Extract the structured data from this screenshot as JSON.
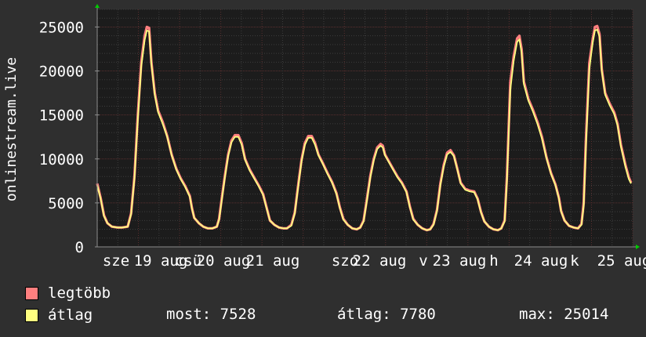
{
  "chart_data": {
    "type": "area",
    "ylabel": "onlinestream.live",
    "ylim": [
      0,
      27000
    ],
    "y_ticks": [
      "0",
      "5000",
      "10000",
      "15000",
      "20000",
      "25000"
    ],
    "x_tick_labels": [
      "sze",
      "19 aug",
      "csü",
      "20 aug",
      "21 aug",
      "szo",
      "22 aug",
      "v",
      "23 aug",
      "h",
      "24 aug",
      "k",
      "25 aug"
    ],
    "grid": true,
    "series": [
      {
        "name": "legtöbb",
        "color": "#ff7f7f",
        "points": [
          [
            0,
            7200
          ],
          [
            3,
            5600
          ],
          [
            6,
            3600
          ],
          [
            9,
            2700
          ],
          [
            13,
            2300
          ],
          [
            18,
            2200
          ],
          [
            22,
            2200
          ],
          [
            27,
            2300
          ],
          [
            30,
            3800
          ],
          [
            33,
            8000
          ],
          [
            36,
            15000
          ],
          [
            39,
            21000
          ],
          [
            42,
            24000
          ],
          [
            44,
            25000
          ],
          [
            46,
            24900
          ],
          [
            48,
            21000
          ],
          [
            51,
            17500
          ],
          [
            54,
            15500
          ],
          [
            58,
            14200
          ],
          [
            62,
            12600
          ],
          [
            66,
            10500
          ],
          [
            70,
            8900
          ],
          [
            74,
            7800
          ],
          [
            78,
            6900
          ],
          [
            82,
            5800
          ],
          [
            84,
            4400
          ],
          [
            86,
            3300
          ],
          [
            90,
            2700
          ],
          [
            94,
            2300
          ],
          [
            98,
            2100
          ],
          [
            102,
            2100
          ],
          [
            106,
            2300
          ],
          [
            108,
            3200
          ],
          [
            110,
            5200
          ],
          [
            113,
            8000
          ],
          [
            116,
            10500
          ],
          [
            119,
            12100
          ],
          [
            122,
            12700
          ],
          [
            125,
            12700
          ],
          [
            128,
            11800
          ],
          [
            131,
            10000
          ],
          [
            135,
            8800
          ],
          [
            139,
            7900
          ],
          [
            143,
            7000
          ],
          [
            147,
            6000
          ],
          [
            150,
            4500
          ],
          [
            153,
            3000
          ],
          [
            157,
            2500
          ],
          [
            161,
            2200
          ],
          [
            165,
            2100
          ],
          [
            168,
            2100
          ],
          [
            172,
            2500
          ],
          [
            175,
            3900
          ],
          [
            178,
            7000
          ],
          [
            181,
            9900
          ],
          [
            184,
            11800
          ],
          [
            187,
            12600
          ],
          [
            190,
            12600
          ],
          [
            193,
            11800
          ],
          [
            196,
            10500
          ],
          [
            200,
            9500
          ],
          [
            204,
            8400
          ],
          [
            208,
            7400
          ],
          [
            212,
            6100
          ],
          [
            215,
            4500
          ],
          [
            218,
            3200
          ],
          [
            222,
            2500
          ],
          [
            226,
            2100
          ],
          [
            230,
            2000
          ],
          [
            233,
            2200
          ],
          [
            236,
            3000
          ],
          [
            239,
            5500
          ],
          [
            242,
            8100
          ],
          [
            245,
            10000
          ],
          [
            248,
            11300
          ],
          [
            251,
            11700
          ],
          [
            253,
            11500
          ],
          [
            255,
            10500
          ],
          [
            258,
            9800
          ],
          [
            262,
            8900
          ],
          [
            266,
            8000
          ],
          [
            270,
            7300
          ],
          [
            274,
            6300
          ],
          [
            277,
            4600
          ],
          [
            280,
            3200
          ],
          [
            284,
            2500
          ],
          [
            288,
            2100
          ],
          [
            292,
            1900
          ],
          [
            295,
            2000
          ],
          [
            298,
            2600
          ],
          [
            301,
            4200
          ],
          [
            304,
            7200
          ],
          [
            307,
            9300
          ],
          [
            310,
            10700
          ],
          [
            313,
            11000
          ],
          [
            316,
            10400
          ],
          [
            319,
            8900
          ],
          [
            322,
            7300
          ],
          [
            326,
            6600
          ],
          [
            330,
            6400
          ],
          [
            334,
            6300
          ],
          [
            337,
            5500
          ],
          [
            340,
            4000
          ],
          [
            343,
            2900
          ],
          [
            347,
            2300
          ],
          [
            351,
            2000
          ],
          [
            355,
            1900
          ],
          [
            358,
            2100
          ],
          [
            361,
            3000
          ],
          [
            363,
            8000
          ],
          [
            366,
            18700
          ],
          [
            369,
            21700
          ],
          [
            372,
            23700
          ],
          [
            374,
            24000
          ],
          [
            376,
            22500
          ],
          [
            378,
            18800
          ],
          [
            382,
            16800
          ],
          [
            386,
            15600
          ],
          [
            390,
            14200
          ],
          [
            394,
            12500
          ],
          [
            398,
            10200
          ],
          [
            402,
            8400
          ],
          [
            406,
            7100
          ],
          [
            409,
            5600
          ],
          [
            411,
            4100
          ],
          [
            414,
            3000
          ],
          [
            418,
            2400
          ],
          [
            422,
            2200
          ],
          [
            426,
            2100
          ],
          [
            429,
            2600
          ],
          [
            431,
            5000
          ],
          [
            433,
            12300
          ],
          [
            436,
            20900
          ],
          [
            439,
            23600
          ],
          [
            441,
            25000
          ],
          [
            443,
            25100
          ],
          [
            445,
            24200
          ],
          [
            447,
            20200
          ],
          [
            450,
            17500
          ],
          [
            454,
            16300
          ],
          [
            458,
            15300
          ],
          [
            461,
            14000
          ],
          [
            464,
            11600
          ],
          [
            468,
            9300
          ],
          [
            471,
            7900
          ],
          [
            473,
            7300
          ]
        ]
      },
      {
        "name": "átlag",
        "color": "#ffff80",
        "points": [
          [
            0,
            7000
          ],
          [
            3,
            5500
          ],
          [
            6,
            3500
          ],
          [
            9,
            2700
          ],
          [
            13,
            2300
          ],
          [
            18,
            2200
          ],
          [
            22,
            2200
          ],
          [
            27,
            2300
          ],
          [
            30,
            3700
          ],
          [
            33,
            7800
          ],
          [
            36,
            14500
          ],
          [
            39,
            20500
          ],
          [
            42,
            23500
          ],
          [
            44,
            24600
          ],
          [
            46,
            24500
          ],
          [
            48,
            20800
          ],
          [
            51,
            17300
          ],
          [
            54,
            15300
          ],
          [
            58,
            14000
          ],
          [
            62,
            12500
          ],
          [
            66,
            10400
          ],
          [
            70,
            8800
          ],
          [
            74,
            7700
          ],
          [
            78,
            6800
          ],
          [
            82,
            5700
          ],
          [
            84,
            4300
          ],
          [
            86,
            3300
          ],
          [
            90,
            2700
          ],
          [
            94,
            2300
          ],
          [
            98,
            2100
          ],
          [
            102,
            2100
          ],
          [
            106,
            2300
          ],
          [
            108,
            3100
          ],
          [
            110,
            5000
          ],
          [
            113,
            7800
          ],
          [
            116,
            10300
          ],
          [
            119,
            11900
          ],
          [
            122,
            12500
          ],
          [
            125,
            12500
          ],
          [
            128,
            11600
          ],
          [
            131,
            9900
          ],
          [
            135,
            8700
          ],
          [
            139,
            7800
          ],
          [
            143,
            6900
          ],
          [
            147,
            5900
          ],
          [
            150,
            4400
          ],
          [
            153,
            3000
          ],
          [
            157,
            2500
          ],
          [
            161,
            2200
          ],
          [
            165,
            2100
          ],
          [
            168,
            2100
          ],
          [
            172,
            2400
          ],
          [
            175,
            3800
          ],
          [
            178,
            6800
          ],
          [
            181,
            9700
          ],
          [
            184,
            11600
          ],
          [
            187,
            12400
          ],
          [
            190,
            12400
          ],
          [
            193,
            11600
          ],
          [
            196,
            10400
          ],
          [
            200,
            9400
          ],
          [
            204,
            8300
          ],
          [
            208,
            7300
          ],
          [
            212,
            6000
          ],
          [
            215,
            4400
          ],
          [
            218,
            3100
          ],
          [
            222,
            2500
          ],
          [
            226,
            2100
          ],
          [
            230,
            2000
          ],
          [
            233,
            2200
          ],
          [
            236,
            2900
          ],
          [
            239,
            5300
          ],
          [
            242,
            7900
          ],
          [
            245,
            9800
          ],
          [
            248,
            11100
          ],
          [
            251,
            11500
          ],
          [
            253,
            11300
          ],
          [
            255,
            10400
          ],
          [
            258,
            9700
          ],
          [
            262,
            8800
          ],
          [
            266,
            7900
          ],
          [
            270,
            7200
          ],
          [
            274,
            6200
          ],
          [
            277,
            4500
          ],
          [
            280,
            3100
          ],
          [
            284,
            2500
          ],
          [
            288,
            2100
          ],
          [
            292,
            1900
          ],
          [
            295,
            2000
          ],
          [
            298,
            2500
          ],
          [
            301,
            4100
          ],
          [
            304,
            7000
          ],
          [
            307,
            9100
          ],
          [
            310,
            10500
          ],
          [
            313,
            10800
          ],
          [
            316,
            10300
          ],
          [
            319,
            8800
          ],
          [
            322,
            7200
          ],
          [
            326,
            6500
          ],
          [
            330,
            6300
          ],
          [
            334,
            6200
          ],
          [
            337,
            5400
          ],
          [
            340,
            3900
          ],
          [
            343,
            2900
          ],
          [
            347,
            2300
          ],
          [
            351,
            2000
          ],
          [
            355,
            1900
          ],
          [
            358,
            2100
          ],
          [
            361,
            2900
          ],
          [
            363,
            7500
          ],
          [
            366,
            17800
          ],
          [
            369,
            21200
          ],
          [
            372,
            23300
          ],
          [
            374,
            23600
          ],
          [
            376,
            22100
          ],
          [
            378,
            18500
          ],
          [
            382,
            16600
          ],
          [
            386,
            15400
          ],
          [
            390,
            14000
          ],
          [
            394,
            12300
          ],
          [
            398,
            10100
          ],
          [
            402,
            8300
          ],
          [
            406,
            7000
          ],
          [
            409,
            5500
          ],
          [
            411,
            4000
          ],
          [
            414,
            3000
          ],
          [
            418,
            2400
          ],
          [
            422,
            2200
          ],
          [
            426,
            2100
          ],
          [
            429,
            2500
          ],
          [
            431,
            4600
          ],
          [
            433,
            11500
          ],
          [
            436,
            20200
          ],
          [
            439,
            23200
          ],
          [
            441,
            24600
          ],
          [
            443,
            24700
          ],
          [
            445,
            23900
          ],
          [
            447,
            20000
          ],
          [
            450,
            17300
          ],
          [
            454,
            16100
          ],
          [
            458,
            15100
          ],
          [
            461,
            13800
          ],
          [
            464,
            11400
          ],
          [
            468,
            9100
          ],
          [
            471,
            7700
          ],
          [
            473,
            7200
          ]
        ]
      }
    ],
    "colors": {
      "background": "#2f2f2f",
      "plot_background": "#1c1c1c",
      "grid_minor": "#3d3d3d",
      "grid_major": "#5a2f2f",
      "axis": "#8c8c8c",
      "arrow": "#00cc00"
    }
  },
  "legend": {
    "max_label": "legtöbb",
    "avg_label": "átlag"
  },
  "stats": {
    "now": "most: 7528",
    "avg": "átlag: 7780",
    "max": "max: 25014"
  }
}
